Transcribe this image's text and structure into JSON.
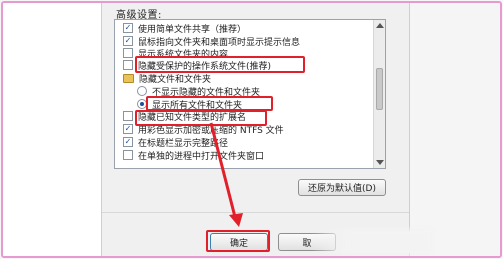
{
  "advanced_settings_label": "高级设置:",
  "items": [
    {
      "kind": "checkbox",
      "checked": true,
      "indent": 0,
      "label": "使用简单文件共享（推荐）"
    },
    {
      "kind": "checkbox",
      "checked": true,
      "indent": 0,
      "label": "鼠标指向文件夹和桌面项时显示提示信息"
    },
    {
      "kind": "checkbox",
      "checked": false,
      "indent": 0,
      "label": "显示系统文件夹的内容"
    },
    {
      "kind": "checkbox",
      "checked": false,
      "indent": 0,
      "label": "隐藏受保护的操作系统文件(推荐)"
    },
    {
      "kind": "folder",
      "checked": false,
      "indent": 0,
      "label": "隐藏文件和文件夹"
    },
    {
      "kind": "radio",
      "checked": false,
      "indent": 1,
      "label": "不显示隐藏的文件和文件夹"
    },
    {
      "kind": "radio",
      "checked": true,
      "indent": 1,
      "label": "显示所有文件和文件夹"
    },
    {
      "kind": "checkbox",
      "checked": false,
      "indent": 0,
      "label": "隐藏已知文件类型的扩展名"
    },
    {
      "kind": "checkbox",
      "checked": true,
      "indent": 0,
      "label": "用彩色显示加密或压缩的 NTFS 文件"
    },
    {
      "kind": "checkbox",
      "checked": true,
      "indent": 0,
      "label": "在标题栏显示完整路径"
    },
    {
      "kind": "checkbox",
      "checked": false,
      "indent": 0,
      "label": "在单独的进程中打开文件夹窗口"
    }
  ],
  "restore_defaults_label": "还原为默认值(D)",
  "ok_label": "确定",
  "cancel_label": "取",
  "colors": {
    "highlight": "#e2202a",
    "frame": "#e79ad0",
    "check": "#1f4f9a"
  }
}
